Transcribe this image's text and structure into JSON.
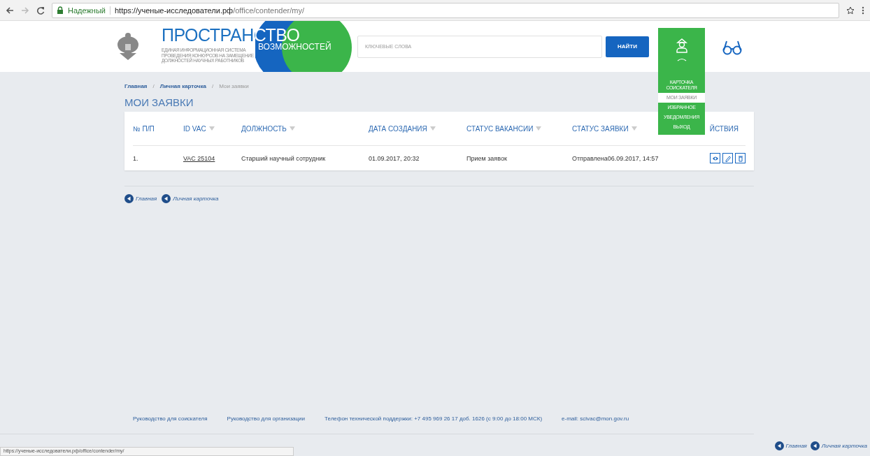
{
  "browser": {
    "security_label": "Надежный",
    "url_host": "https://ученые-исследователи.рф",
    "url_path": "/office/contender/my/"
  },
  "header": {
    "logo_title": "ПРОСТРАНСТВО",
    "logo_subtitle": "ВОЗМОЖНОСТЕЙ",
    "logo_caption": [
      "ЕДИНАЯ ИНФОРМАЦИОННАЯ СИСТЕМА",
      "ПРОВЕДЕНИЯ КОНКУРСОВ НА ЗАМЕЩЕНИЕ",
      "ДОЛЖНОСТЕЙ НАУЧНЫХ РАБОТНИКОВ"
    ],
    "search": {
      "placeholder": "КЛЮЧЕВЫЕ СЛОВА"
    },
    "search_button": "НАЙТИ",
    "account_menu": {
      "expanded": true,
      "items": [
        {
          "label": "КАРТОЧКА СОИСКАТЕЛЯ",
          "selected": false
        },
        {
          "label": "МОИ ЗАЯВКИ",
          "selected": true
        },
        {
          "label": "ИЗБРАННОЕ",
          "selected": false
        },
        {
          "label": "УВЕДОМЛЕНИЯ",
          "selected": false
        },
        {
          "label": "ВЫХОД",
          "selected": false
        }
      ]
    }
  },
  "breadcrumbs": {
    "separator": "/",
    "items": [
      {
        "label": "Главная",
        "current": false
      },
      {
        "label": "Личная карточка",
        "current": false
      },
      {
        "label": "Мои заявки",
        "current": true
      }
    ]
  },
  "page_title": "МОИ ЗАЯВКИ",
  "table": {
    "columns": [
      {
        "label": "№ П/П",
        "sortable": false
      },
      {
        "label": "ID VAC",
        "sortable": true
      },
      {
        "label": "ДОЛЖНОСТЬ",
        "sortable": true
      },
      {
        "label": "ДАТА СОЗДАНИЯ",
        "sortable": true
      },
      {
        "label": "СТАТУС ВАКАНСИИ",
        "sortable": true
      },
      {
        "label": "СТАТУС ЗАЯВКИ",
        "sortable": true
      },
      {
        "label": "ЙСТВИЯ",
        "sortable": false
      }
    ],
    "rows": [
      {
        "number": "1.",
        "vac_id": "VAC 25104",
        "position": "Старший научный сотрудник",
        "created": "01.09.2017, 20:32",
        "vacancy_status": "Прием заявок",
        "application_status": "Отправлена06.09.2017, 14:57"
      }
    ]
  },
  "back_links": [
    "Главная",
    "Личная карточка"
  ],
  "footer": {
    "links": [
      "Руководство для соискателя",
      "Руководство для организации",
      "Телефон технической поддержки: +7 495 969 26 17 доб. 1626 (с 9:00 до 18:00 МСК)",
      "e-mail: scivac@mon.gov.ru"
    ]
  },
  "bottom_links": [
    "Главная",
    "Личная карточка"
  ],
  "status_url": "https://ученые-исследователи.рф/office/contender/my/"
}
